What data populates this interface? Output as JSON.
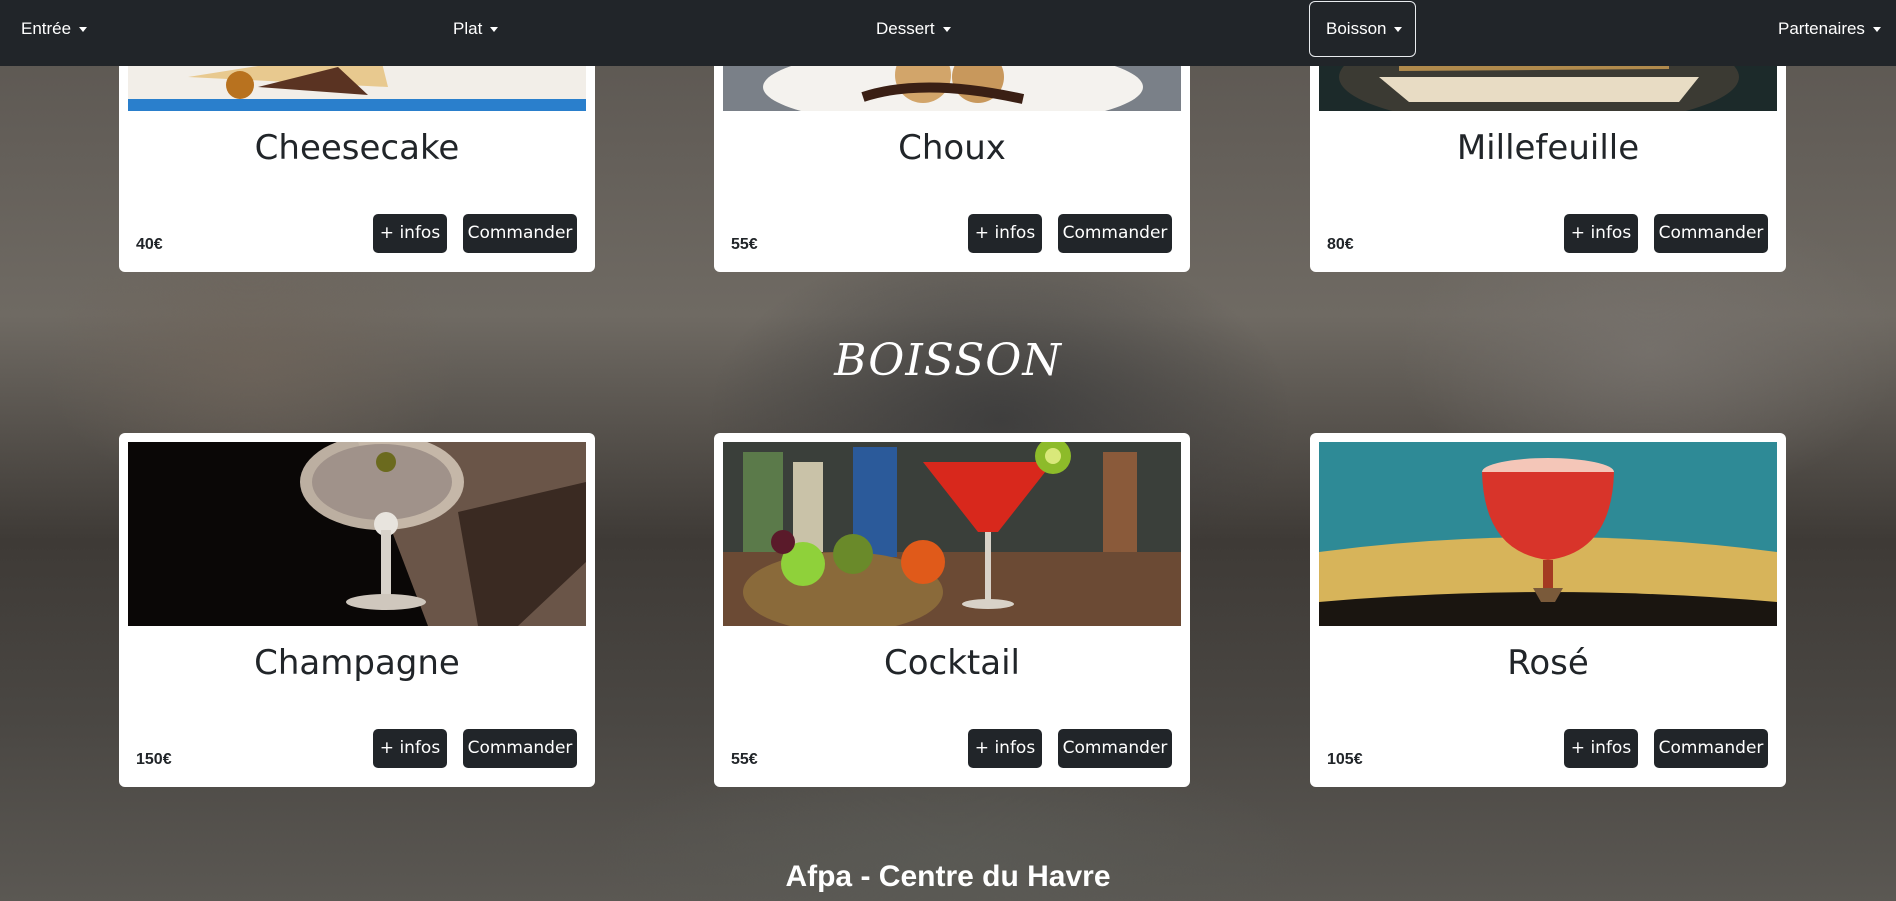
{
  "nav": {
    "items": [
      {
        "label": "Entrée"
      },
      {
        "label": "Plat"
      },
      {
        "label": "Dessert"
      },
      {
        "label": "Boisson"
      },
      {
        "label": "Partenaires"
      }
    ]
  },
  "dessert_cards": [
    {
      "title": "Cheesecake",
      "price": "40€",
      "infos_label": "+ infos",
      "order_label": "Commander"
    },
    {
      "title": "Choux",
      "price": "55€",
      "infos_label": "+ infos",
      "order_label": "Commander"
    },
    {
      "title": "Millefeuille",
      "price": "80€",
      "infos_label": "+ infos",
      "order_label": "Commander"
    }
  ],
  "boisson_section": {
    "title": "BOISSON",
    "cards": [
      {
        "title": "Champagne",
        "price": "150€",
        "infos_label": "+ infos",
        "order_label": "Commander"
      },
      {
        "title": "Cocktail",
        "price": "55€",
        "infos_label": "+ infos",
        "order_label": "Commander"
      },
      {
        "title": "Rosé",
        "price": "105€",
        "infos_label": "+ infos",
        "order_label": "Commander"
      }
    ]
  },
  "footer": {
    "text": "Afpa - Centre du Havre"
  }
}
